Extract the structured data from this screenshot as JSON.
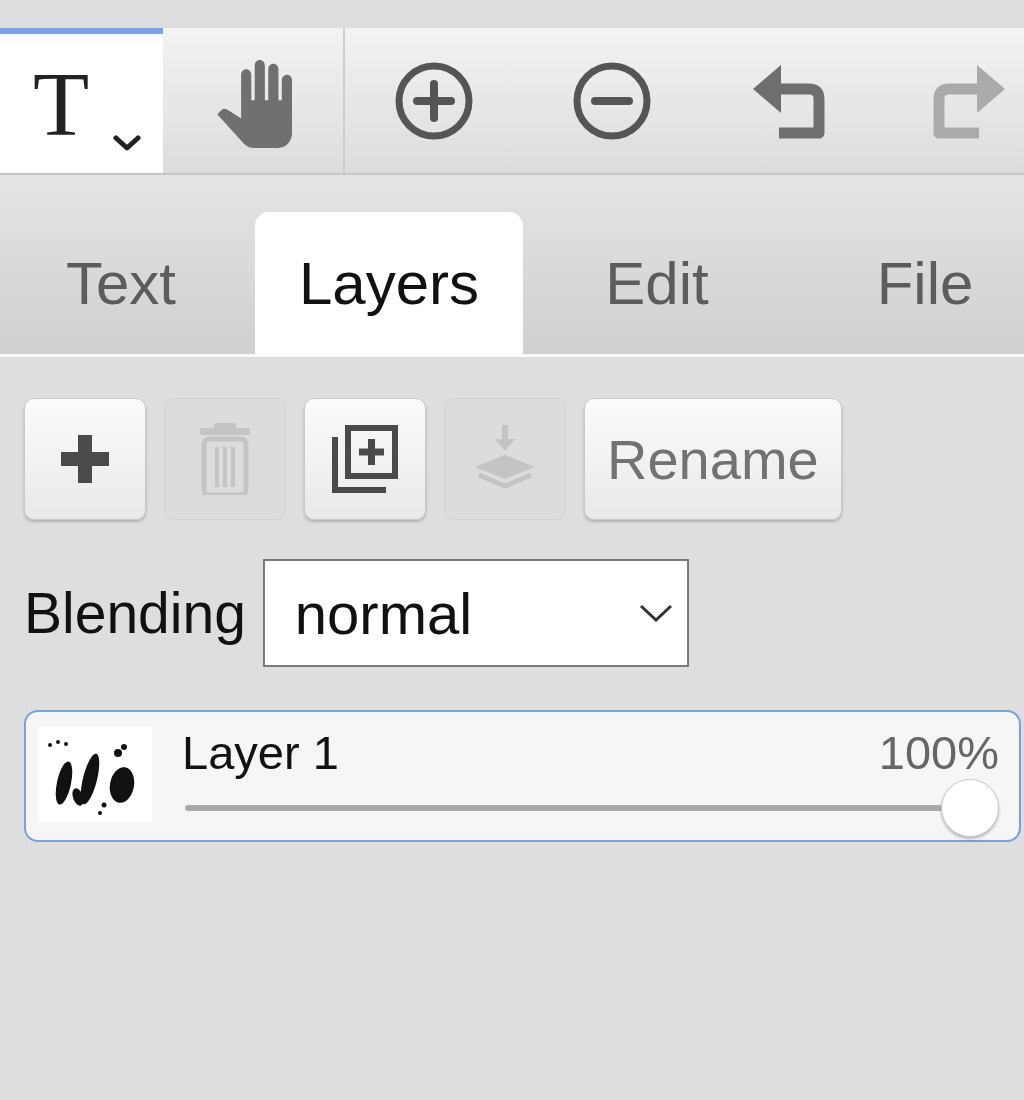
{
  "toolbar": {
    "tools": [
      {
        "kind": "text",
        "label": "T",
        "selected": true
      },
      {
        "kind": "hand",
        "selected": false
      }
    ],
    "actions": [
      {
        "kind": "zoom-in",
        "disabled": false
      },
      {
        "kind": "zoom-out",
        "disabled": false
      },
      {
        "kind": "undo",
        "disabled": false
      },
      {
        "kind": "redo",
        "disabled": true
      }
    ]
  },
  "tabs": [
    {
      "label": "Text",
      "selected": false
    },
    {
      "label": "Layers",
      "selected": true
    },
    {
      "label": "Edit",
      "selected": false
    },
    {
      "label": "File",
      "selected": false
    }
  ],
  "layer_actions": [
    {
      "kind": "add",
      "disabled": false
    },
    {
      "kind": "delete",
      "disabled": true
    },
    {
      "kind": "duplicate",
      "disabled": false
    },
    {
      "kind": "merge-down",
      "disabled": true
    },
    {
      "kind": "rename",
      "label": "Rename",
      "disabled": false
    }
  ],
  "blending": {
    "label": "Blending",
    "value": "normal"
  },
  "layers": [
    {
      "name": "Layer 1",
      "opacity": "100%",
      "level": 1,
      "selected": true
    }
  ]
}
